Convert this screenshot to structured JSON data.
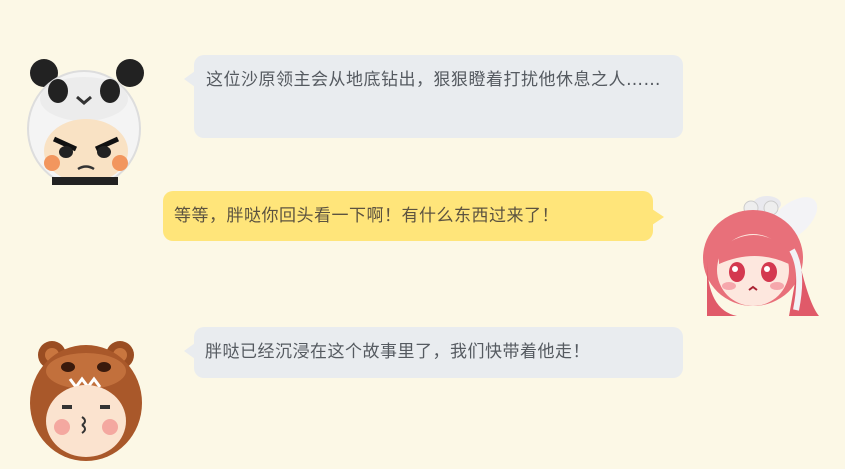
{
  "messages": [
    {
      "speaker": "panda",
      "side": "left",
      "text": "这位沙原领主会从地底钻出，狠狠瞪着打扰他休息之人……",
      "avatar_icon": "panda-hood-avatar-icon",
      "bubble_color": "#e9ecef"
    },
    {
      "speaker": "pink-hair-girl",
      "side": "right",
      "text": "等等，胖哒你回头看一下啊！有什么东西过来了！",
      "avatar_icon": "pink-hair-bunny-girl-avatar-icon",
      "bubble_color": "#ffe57a"
    },
    {
      "speaker": "bear",
      "side": "left",
      "text": "胖哒已经沉浸在这个故事里了，我们快带着他走！",
      "avatar_icon": "bear-hood-avatar-icon",
      "bubble_color": "#e9ecef"
    }
  ],
  "colors": {
    "background": "#fcf8e6",
    "left_bubble": "#e9ecef",
    "right_bubble": "#ffe57a"
  }
}
